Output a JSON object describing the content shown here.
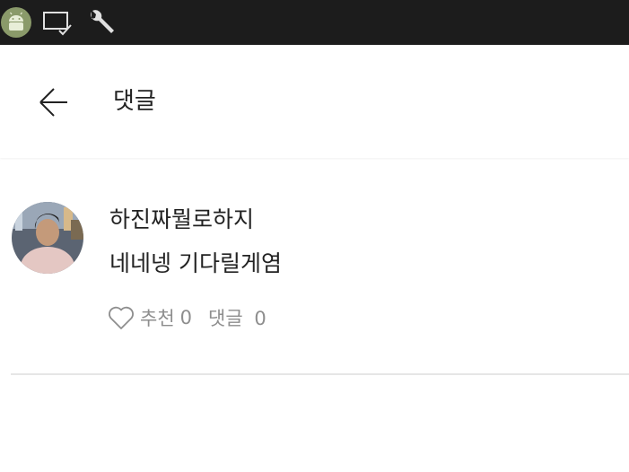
{
  "header": {
    "title": "댓글",
    "back_icon": "arrow-left-icon"
  },
  "status_bar": {
    "icons": [
      "android-icon",
      "cast-check-icon",
      "wrench-icon"
    ]
  },
  "comment": {
    "author": "하진짜뭘로하지",
    "body": "네네넹 기다릴게염",
    "like_label": "추천",
    "like_count": "0",
    "reply_label": "댓글",
    "reply_count": "0"
  },
  "colors": {
    "status_bar_bg": "#1c1c1c",
    "text_primary": "#222222",
    "text_secondary": "#8e8e8e",
    "divider": "#e6e6e6"
  }
}
